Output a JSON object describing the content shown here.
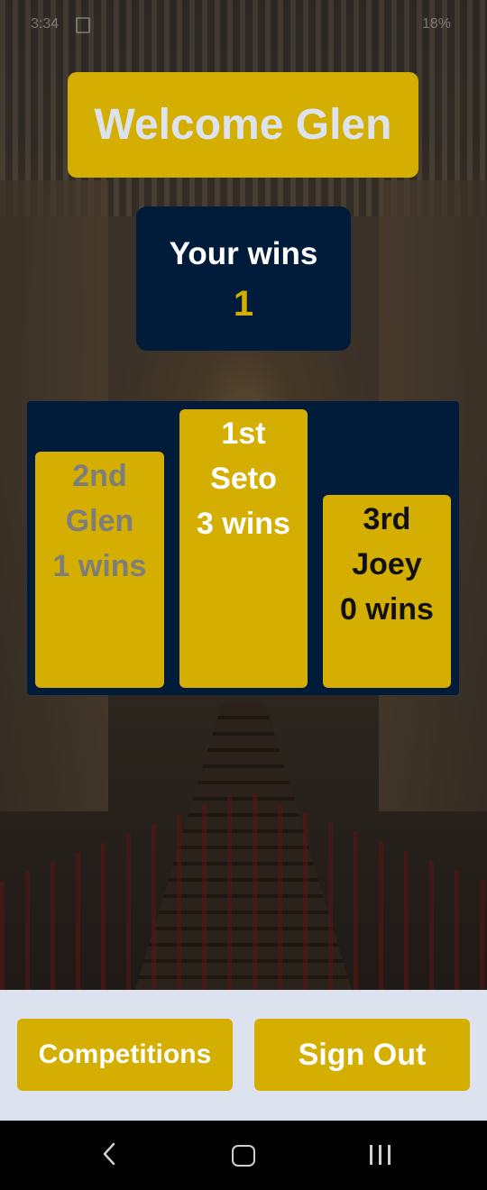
{
  "statusbar": {
    "time": "3:34",
    "battery": "18%"
  },
  "header": {
    "welcome_text": "Welcome Glen"
  },
  "wins_card": {
    "label": "Your wins",
    "count": "1"
  },
  "podium": {
    "second": {
      "place": "2nd",
      "name": "Glen",
      "wins": "1 wins"
    },
    "first": {
      "place": "1st",
      "name": "Seto",
      "wins": "3 wins"
    },
    "third": {
      "place": "3rd",
      "name": "Joey",
      "wins": "0 wins"
    }
  },
  "actions": {
    "competitions_label": "Competitions",
    "sign_out_label": "Sign Out"
  },
  "navbar": {
    "back": "back-icon",
    "home": "home-icon",
    "recents": "recents-icon"
  },
  "colors": {
    "gold": "#d4ae00",
    "navy": "#011b3a",
    "light": "#dde3ee"
  }
}
